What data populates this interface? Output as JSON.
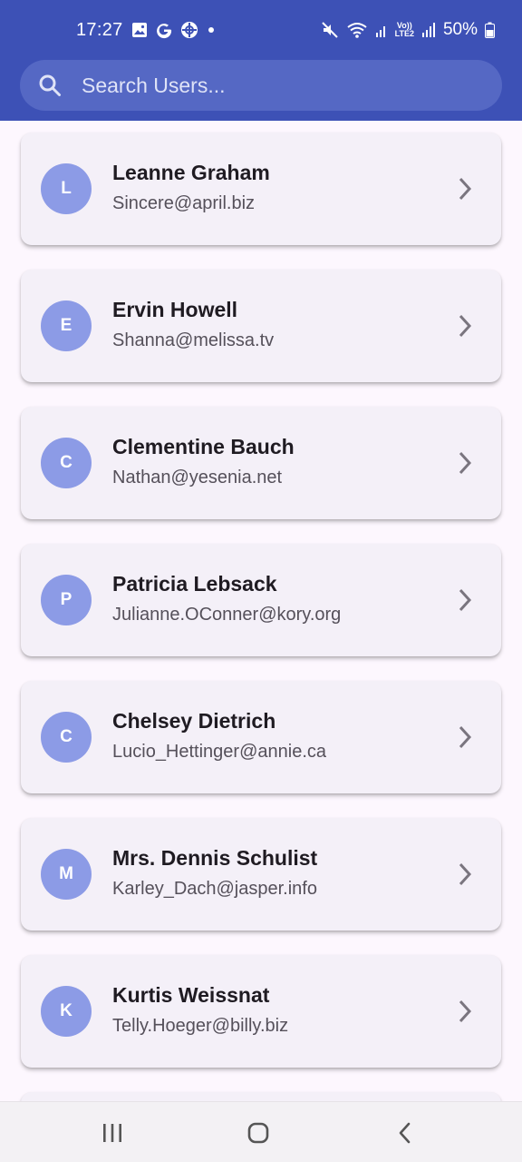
{
  "status_bar": {
    "time": "17:27",
    "left_icons": [
      "gallery-icon",
      "google-icon",
      "app-icon",
      "dot-icon"
    ],
    "right_icons": [
      "mute-icon",
      "wifi-icon",
      "signal-icon",
      "volte-icon",
      "signal-icon"
    ],
    "volte_label_top": "Vo))",
    "volte_label_bottom": "LTE2",
    "battery": "50%"
  },
  "colors": {
    "header": "#3d51b6",
    "search_bg": "#5568c4",
    "avatar": "#8c9be6",
    "card": "#f4f0f8",
    "background": "#fdf7fe"
  },
  "search": {
    "placeholder": "Search Users...",
    "icon": "search-icon"
  },
  "users": [
    {
      "initial": "L",
      "name": "Leanne Graham",
      "email": "Sincere@april.biz"
    },
    {
      "initial": "E",
      "name": "Ervin Howell",
      "email": "Shanna@melissa.tv"
    },
    {
      "initial": "C",
      "name": "Clementine Bauch",
      "email": "Nathan@yesenia.net"
    },
    {
      "initial": "P",
      "name": "Patricia Lebsack",
      "email": "Julianne.OConner@kory.org"
    },
    {
      "initial": "C",
      "name": "Chelsey Dietrich",
      "email": "Lucio_Hettinger@annie.ca"
    },
    {
      "initial": "M",
      "name": "Mrs. Dennis Schulist",
      "email": "Karley_Dach@jasper.info"
    },
    {
      "initial": "K",
      "name": "Kurtis Weissnat",
      "email": "Telly.Hoeger@billy.biz"
    }
  ],
  "nav_bar": {
    "buttons": [
      "recent-apps-icon",
      "home-icon",
      "back-icon"
    ]
  }
}
